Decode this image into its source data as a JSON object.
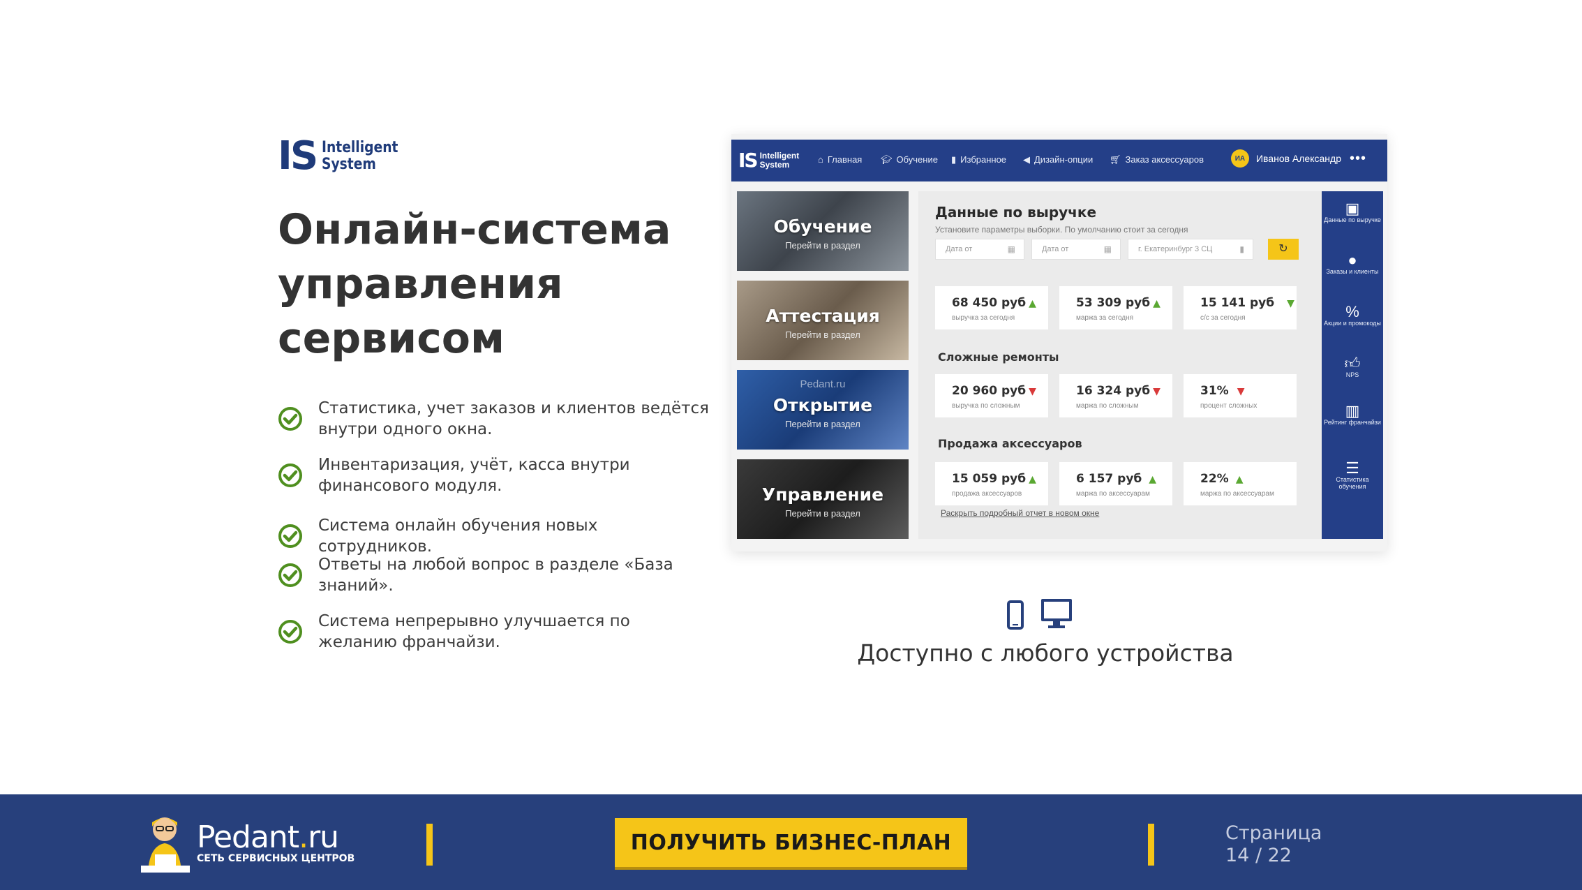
{
  "logo": {
    "mark": "IS",
    "line1": "Intelligent",
    "line2": "System"
  },
  "headline": [
    "Онлайн-система",
    "управления",
    "сервисом"
  ],
  "features": [
    "Статистика, учет заказов и клиентов ведётся внутри одного окна.",
    "Инвентаризация, учёт, касса внутри финансового модуля.",
    "Система онлайн обучения новых сотрудников.",
    "Ответы на любой вопрос в разделе «База знаний».",
    "Система непрерывно улучшается по желанию франчайзи."
  ],
  "dashboard": {
    "logo": {
      "mark": "IS",
      "line1": "Intelligent",
      "line2": "System"
    },
    "nav": [
      {
        "icon": "home-icon",
        "label": "Главная"
      },
      {
        "icon": "graduation-cap-icon",
        "label": "Обучение"
      },
      {
        "icon": "bookmark-icon",
        "label": "Избранное"
      },
      {
        "icon": "megaphone-icon",
        "label": "Дизайн-опции"
      },
      {
        "icon": "cart-icon",
        "label": "Заказ аксессуаров"
      }
    ],
    "user": {
      "initials": "ИА",
      "name": "Иванов Александр",
      "more": "•••"
    },
    "tiles": [
      {
        "title": "Обучение",
        "subtitle": "Перейти в раздел"
      },
      {
        "title": "Аттестация",
        "subtitle": "Перейти в раздел"
      },
      {
        "title": "Открытие",
        "subtitle": "Перейти в раздел",
        "watermark": "Pedant.ru"
      },
      {
        "title": "Управление",
        "subtitle": "Перейти в раздел"
      }
    ],
    "panel": {
      "title": "Данные по выручке",
      "subtitle": "Установите параметры выборки. По умолчанию стоит за сегодня",
      "filters": [
        "Дата от",
        "Дата от",
        "г. Екатеринбург 3 СЦ"
      ],
      "revenue_cards": [
        {
          "value": "68 450 руб",
          "label": "выручка за сегодня",
          "trend": "up"
        },
        {
          "value": "53 309 руб",
          "label": "маржа за сегодня",
          "trend": "up"
        },
        {
          "value": "15 141 руб",
          "label": "с/с за сегодня",
          "trend": "down-green"
        }
      ],
      "complex_title": "Сложные ремонты",
      "complex_cards": [
        {
          "value": "20 960 руб",
          "label": "выручка по сложным",
          "trend": "down"
        },
        {
          "value": "16 324 руб",
          "label": "маржа по сложным",
          "trend": "down"
        },
        {
          "value": "31%",
          "label": "процент сложных",
          "trend": "down"
        }
      ],
      "accessories_title": "Продажа аксессуаров",
      "accessories_cards": [
        {
          "value": "15 059 руб",
          "label": "продажа аксессуаров",
          "trend": "up"
        },
        {
          "value": "6 157 руб",
          "label": "маржа по аксессуарам",
          "trend": "up"
        },
        {
          "value": "22%",
          "label": "маржа по аксессуарам",
          "trend": "up"
        }
      ],
      "report_link": "Раскрыть подробный отчет в новом окне"
    },
    "sidebar": [
      {
        "icon": "money-icon",
        "label": "Данные по выручке"
      },
      {
        "icon": "user-icon",
        "label": "Заказы и клиенты"
      },
      {
        "icon": "percent-icon",
        "label": "Акции и промокоды"
      },
      {
        "icon": "thumbs-up-icon",
        "label": "NPS"
      },
      {
        "icon": "bar-chart-icon",
        "label": "Рейтинг франчайзи"
      },
      {
        "icon": "list-icon",
        "label": "Статистика обучения"
      }
    ]
  },
  "devices_caption": "Доступно с любого устройства",
  "footer": {
    "brand_name": "Pedant",
    "brand_dot": ".",
    "brand_tld": "ru",
    "brand_sub": "СЕТЬ СЕРВИСНЫХ ЦЕНТРОВ",
    "cta": "ПОЛУЧИТЬ БИЗНЕС-ПЛАН",
    "page_word": "Страница",
    "page_num": "14 / 22"
  },
  "colors": {
    "brand_blue": "#27407c",
    "accent_yellow": "#f5c518",
    "check_green": "#4f8f1f"
  }
}
